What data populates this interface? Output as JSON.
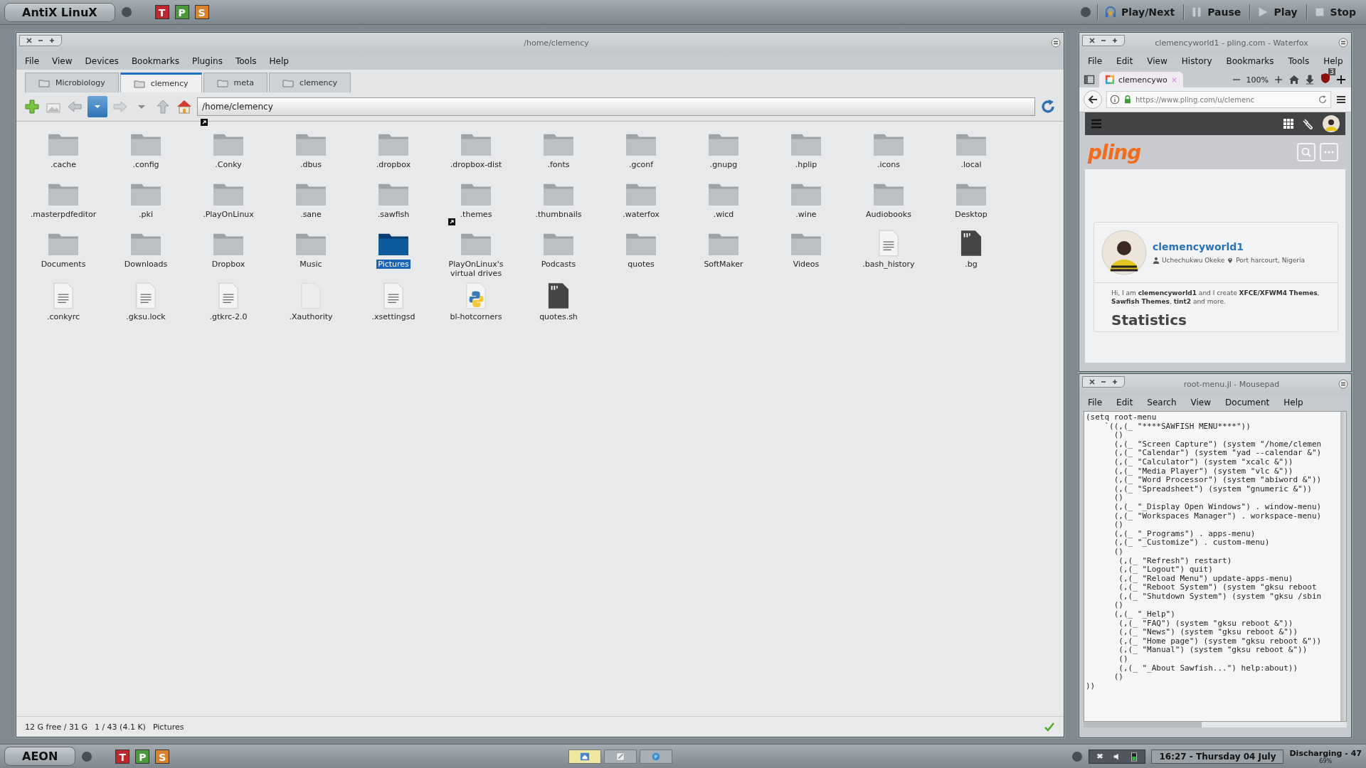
{
  "top_panel": {
    "menu_label": "AntiX LinuX",
    "launchers": [
      {
        "letter": "T",
        "color": "#c0272d"
      },
      {
        "letter": "P",
        "color": "#4a9a3c"
      },
      {
        "letter": "S",
        "color": "#d9822b"
      }
    ],
    "media_buttons": [
      {
        "label": "Play/Next",
        "kind": "next"
      },
      {
        "label": "Pause",
        "kind": "pause"
      },
      {
        "label": "Play",
        "kind": "play"
      },
      {
        "label": "Stop",
        "kind": "stop"
      }
    ]
  },
  "file_manager": {
    "title": "/home/clemency",
    "menu": [
      "File",
      "View",
      "Devices",
      "Bookmarks",
      "Plugins",
      "Tools",
      "Help"
    ],
    "tabs": [
      {
        "label": "Microbiology",
        "selected": false
      },
      {
        "label": "clemency",
        "selected": true
      },
      {
        "label": "meta",
        "selected": false
      },
      {
        "label": "clemency",
        "selected": false
      }
    ],
    "location": "/home/clemency",
    "files": [
      {
        "name": ".cache",
        "kind": "folder",
        "selected": false,
        "link": false
      },
      {
        "name": ".config",
        "kind": "folder",
        "selected": false,
        "link": false
      },
      {
        "name": ".Conky",
        "kind": "folder",
        "selected": false,
        "link": true
      },
      {
        "name": ".dbus",
        "kind": "folder",
        "selected": false,
        "link": false
      },
      {
        "name": ".dropbox",
        "kind": "folder",
        "selected": false,
        "link": false
      },
      {
        "name": ".dropbox-dist",
        "kind": "folder",
        "selected": false,
        "link": false
      },
      {
        "name": ".fonts",
        "kind": "folder",
        "selected": false,
        "link": false
      },
      {
        "name": ".gconf",
        "kind": "folder",
        "selected": false,
        "link": false
      },
      {
        "name": ".gnupg",
        "kind": "folder",
        "selected": false,
        "link": false
      },
      {
        "name": ".hplip",
        "kind": "folder",
        "selected": false,
        "link": false
      },
      {
        "name": ".icons",
        "kind": "folder",
        "selected": false,
        "link": false
      },
      {
        "name": ".local",
        "kind": "folder",
        "selected": false,
        "link": false
      },
      {
        "name": ".masterpdfeditor",
        "kind": "folder",
        "selected": false,
        "link": false
      },
      {
        "name": ".pki",
        "kind": "folder",
        "selected": false,
        "link": false
      },
      {
        "name": ".PlayOnLinux",
        "kind": "folder",
        "selected": false,
        "link": false
      },
      {
        "name": ".sane",
        "kind": "folder",
        "selected": false,
        "link": false
      },
      {
        "name": ".sawfish",
        "kind": "folder",
        "selected": false,
        "link": false
      },
      {
        "name": ".themes",
        "kind": "folder",
        "selected": false,
        "link": false
      },
      {
        "name": ".thumbnails",
        "kind": "folder",
        "selected": false,
        "link": false
      },
      {
        "name": ".waterfox",
        "kind": "folder",
        "selected": false,
        "link": false
      },
      {
        "name": ".wicd",
        "kind": "folder",
        "selected": false,
        "link": false
      },
      {
        "name": ".wine",
        "kind": "folder",
        "selected": false,
        "link": false
      },
      {
        "name": "Audiobooks",
        "kind": "folder",
        "selected": false,
        "link": false
      },
      {
        "name": "Desktop",
        "kind": "folder",
        "selected": false,
        "link": false
      },
      {
        "name": "Documents",
        "kind": "folder",
        "selected": false,
        "link": false
      },
      {
        "name": "Downloads",
        "kind": "folder",
        "selected": false,
        "link": false
      },
      {
        "name": "Dropbox",
        "kind": "folder",
        "selected": false,
        "link": false
      },
      {
        "name": "Music",
        "kind": "folder",
        "selected": false,
        "link": false
      },
      {
        "name": "Pictures",
        "kind": "folder",
        "selected": true,
        "link": false
      },
      {
        "name": "PlayOnLinux's virtual drives",
        "kind": "folder",
        "selected": false,
        "link": true
      },
      {
        "name": "Podcasts",
        "kind": "folder",
        "selected": false,
        "link": false
      },
      {
        "name": "quotes",
        "kind": "folder",
        "selected": false,
        "link": false
      },
      {
        "name": "SoftMaker",
        "kind": "folder",
        "selected": false,
        "link": false
      },
      {
        "name": "Videos",
        "kind": "folder",
        "selected": false,
        "link": false
      },
      {
        "name": ".bash_history",
        "kind": "text",
        "selected": false,
        "link": false
      },
      {
        "name": ".bg",
        "kind": "script",
        "selected": false,
        "link": false
      },
      {
        "name": ".conkyrc",
        "kind": "text",
        "selected": false,
        "link": false
      },
      {
        "name": ".gksu.lock",
        "kind": "text",
        "selected": false,
        "link": false
      },
      {
        "name": ".gtkrc-2.0",
        "kind": "text",
        "selected": false,
        "link": false
      },
      {
        "name": ".Xauthority",
        "kind": "blank",
        "selected": false,
        "link": false
      },
      {
        "name": ".xsettingsd",
        "kind": "text",
        "selected": false,
        "link": false
      },
      {
        "name": "bl-hotcorners",
        "kind": "python",
        "selected": false,
        "link": false
      },
      {
        "name": "quotes.sh",
        "kind": "script",
        "selected": false,
        "link": false
      }
    ],
    "status": [
      "12 G free / 31 G",
      "1 / 43 (4.1 K)",
      "Pictures"
    ]
  },
  "browser": {
    "title": "clemencyworld1 - pling.com - Waterfox",
    "menu": [
      "File",
      "Edit",
      "View",
      "History",
      "Bookmarks",
      "Tools",
      "Help"
    ],
    "tab": {
      "label": "clemencywo"
    },
    "zoom": "100%",
    "addon_badge": "3",
    "url": "https://www.pling.com/u/clemenc",
    "site": {
      "logo": "pling",
      "profile": {
        "username": "clemencyworld1",
        "name": "Uchechukwu Okeke",
        "location": "Port harcourt, Nigeria",
        "bio": "Hi, I am **clemencyworld1** and I create **XFCE/XFWM4 Themes**, **Sawfish Themes**, **tint2** and more.",
        "heading": "Statistics"
      }
    }
  },
  "editor": {
    "title": "root-menu.jl - Mousepad",
    "menu": [
      "File",
      "Edit",
      "Search",
      "View",
      "Document",
      "Help"
    ],
    "lines": [
      "(setq root-menu",
      "    `((,(_ \"****SAWFISH MENU****\"))",
      "      ()",
      "      (,(_ \"Screen Capture\") (system \"/home/clemen",
      "      (,(_ \"Calendar\") (system \"yad --calendar &\")",
      "      (,(_ \"Calculator\") (system \"xcalc &\"))",
      "      (,(_ \"Media Player\") (system \"vlc &\"))",
      "      (,(_ \"Word Processor\") (system \"abiword &\"))",
      "      (,(_ \"Spreadsheet\") (system \"gnumeric &\"))",
      "      ()",
      "      (,(_ \"_Display Open Windows\") . window-menu)",
      "      (,(_ \"Workspaces Manager\") . workspace-menu)",
      "      ()",
      "      (,(_ \"_Programs\") . apps-menu)",
      "      (,(_ \"_Customize\") . custom-menu)",
      "      ()",
      "       (,(_ \"Refresh\") restart)",
      "       (,(_ \"Logout\") quit)",
      "       (,(_ \"Reload Menu\") update-apps-menu)",
      "       (,(_ \"Reboot System\") (system \"gksu reboot",
      "       (,(_ \"Shutdown System\") (system \"gksu /sbin",
      "      ()",
      "      (,(_ \"_Help\")",
      "       (,(_ \"FAQ\") (system \"gksu reboot &\"))",
      "       (,(_ \"News\") (system \"gksu reboot &\"))",
      "       (,(_ \"Home page\") (system \"gksu reboot &\"))",
      "       (,(_ \"Manual\") (system \"gksu reboot &\"))",
      "       ()",
      "       (,(_ \"_About Sawfish...\") help:about))",
      "      ()",
      "))"
    ]
  },
  "bottom_panel": {
    "menu_label": "AEON",
    "launchers": [
      {
        "letter": "T",
        "color": "#c0272d"
      },
      {
        "letter": "P",
        "color": "#4a9a3c"
      },
      {
        "letter": "S",
        "color": "#d9822b"
      }
    ],
    "tasks": [
      {
        "kind": "home",
        "selected": true
      },
      {
        "kind": "editor",
        "selected": false
      },
      {
        "kind": "browser",
        "selected": false
      }
    ],
    "clock": "16:27 - Thursday 04 July",
    "battery": "Discharging - 47",
    "battery_percent": "69%"
  }
}
